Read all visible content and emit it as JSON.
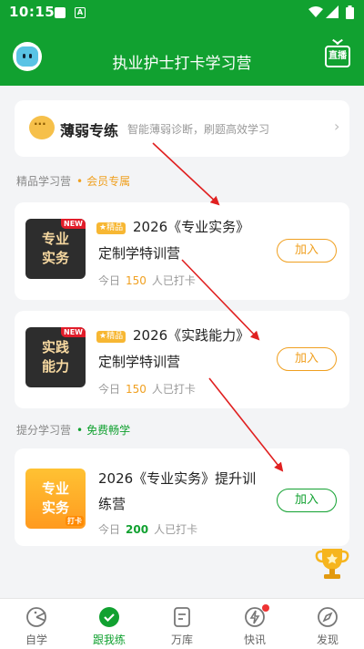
{
  "status_bar": {
    "time": "10:15",
    "icon2": "A"
  },
  "header": {
    "title": "执业护士打卡学习营",
    "live_label": "直播"
  },
  "weak_training": {
    "name": "薄弱专练",
    "desc": "智能薄弱诊断，刷题高效学习"
  },
  "sections": {
    "premium": {
      "label": "精品学习营",
      "tag": "会员专属"
    },
    "boost": {
      "label": "提分学习营",
      "tag": "免费畅学"
    }
  },
  "camps": [
    {
      "thumb_line1": "专业",
      "thumb_line2": "实务",
      "thumb_flag": "NEW",
      "badge": "★精品",
      "title1": "2026《专业实务》",
      "title2": "定制学特训营",
      "count_prefix": "今日",
      "count": "150",
      "count_suffix": "人已打卡",
      "join": "加入"
    },
    {
      "thumb_line1": "实践",
      "thumb_line2": "能力",
      "thumb_flag": "NEW",
      "badge": "★精品",
      "title1": "2026《实践能力》",
      "title2": "定制学特训营",
      "count_prefix": "今日",
      "count": "150",
      "count_suffix": "人已打卡",
      "join": "加入"
    },
    {
      "thumb_line1": "专业",
      "thumb_line2": "实务",
      "thumb_flag": "打卡",
      "title1": "2026《专业实务》提升训",
      "title2": "练营",
      "count_prefix": "今日",
      "count": "200",
      "count_suffix": "人已打卡",
      "join": "加入"
    }
  ],
  "tabs": [
    {
      "label": "自学",
      "icon": "pacman-icon"
    },
    {
      "label": "跟我练",
      "icon": "check-circle-icon",
      "active": true
    },
    {
      "label": "万库",
      "icon": "document-icon"
    },
    {
      "label": "快讯",
      "icon": "lightning-icon",
      "has_dot": true
    },
    {
      "label": "发现",
      "icon": "compass-icon"
    }
  ],
  "colors": {
    "brand_green": "#11a130",
    "accent_orange": "#f0a020",
    "arrow_red": "#e02020"
  }
}
